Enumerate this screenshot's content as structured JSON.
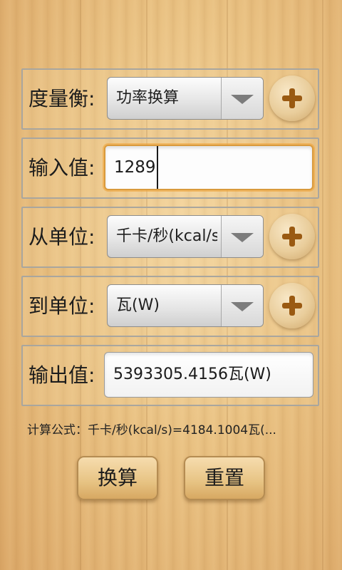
{
  "rows": {
    "measure": {
      "label": "度量衡:",
      "value": "功率换算"
    },
    "input": {
      "label": "输入值:",
      "value": "1289"
    },
    "from_unit": {
      "label": "从单位:",
      "value": "千卡/秒(kcal/s)"
    },
    "to_unit": {
      "label": "到单位:",
      "value": "瓦(W)"
    },
    "output": {
      "label": "输出值:",
      "value": "5393305.4156瓦(W)"
    }
  },
  "formula": "计算公式：千卡/秒(kcal/s)=4184.1004瓦(...",
  "buttons": {
    "convert": "换算",
    "reset": "重置"
  },
  "colors": {
    "accent_plus": "#9a5a12",
    "focus_border": "#d99a3c"
  },
  "icons": {
    "dropdown": "chevron-down-icon",
    "add": "plus-icon"
  }
}
